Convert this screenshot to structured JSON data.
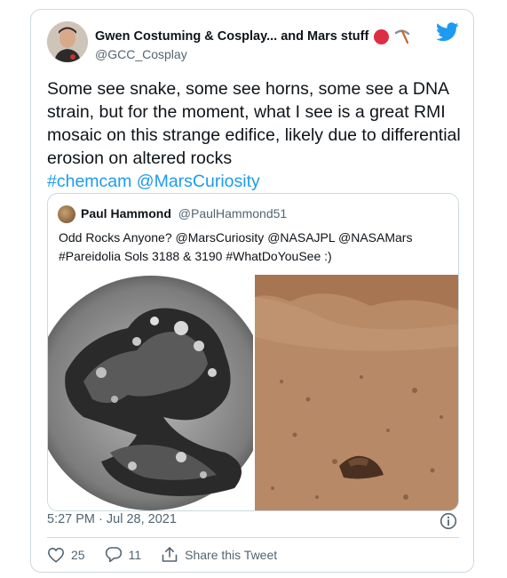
{
  "author": {
    "name": "Gwen Costuming & Cosplay... and Mars stuff",
    "handle": "@GCC_Cosplay"
  },
  "tweet": {
    "text": "Some see snake, some see horns, some see a DNA strain, but for the moment, what I see is a great RMI mosaic on this strange edifice, likely due to differential erosion on altered rocks",
    "hashtag": "#chemcam",
    "mention": "@MarsCuriosity"
  },
  "quote": {
    "name": "Paul Hammond",
    "handle": "@PaulHammond51",
    "text": "Odd Rocks Anyone? @MarsCuriosity @NASAJPL @NASAMars #Pareidolia Sols 3188 & 3190 #WhatDoYouSee :)"
  },
  "meta": {
    "timestamp": "5:27 PM · Jul 28, 2021"
  },
  "actions": {
    "likes": "25",
    "replies": "11",
    "share_label": "Share this Tweet"
  },
  "colors": {
    "link": "#1d9bf0",
    "muted": "#536471",
    "border": "#cfd9de"
  }
}
